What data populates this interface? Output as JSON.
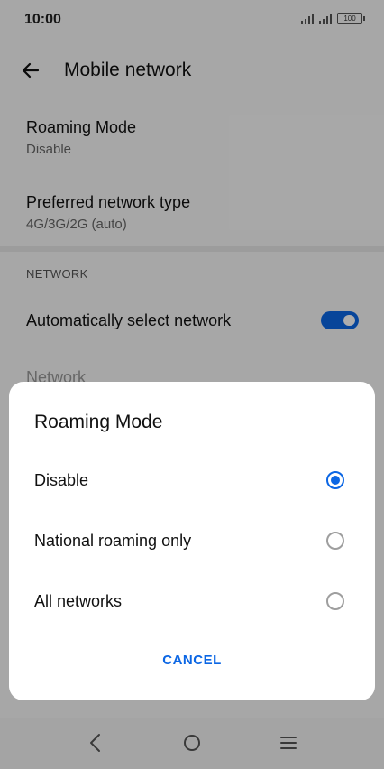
{
  "status_bar": {
    "time": "10:00",
    "battery": "100"
  },
  "app_bar": {
    "title": "Mobile network",
    "back_icon": "arrow-left-icon"
  },
  "settings": {
    "roaming": {
      "title": "Roaming Mode",
      "summary": "Disable"
    },
    "preferred": {
      "title": "Preferred network type",
      "summary": "4G/3G/2G (auto)"
    },
    "section_network": "NETWORK",
    "auto_select": {
      "label": "Automatically select network",
      "enabled": true
    },
    "network_label": "Network"
  },
  "dialog": {
    "title": "Roaming Mode",
    "options": [
      {
        "label": "Disable",
        "selected": true
      },
      {
        "label": "National roaming only",
        "selected": false
      },
      {
        "label": "All networks",
        "selected": false
      }
    ],
    "cancel_label": "CANCEL"
  },
  "nav_bar": {
    "icons": [
      "back-icon",
      "home-icon",
      "menu-icon"
    ]
  },
  "colors": {
    "accent": "#0b66e4",
    "scrim": "rgba(0,0,0,0.32)"
  }
}
